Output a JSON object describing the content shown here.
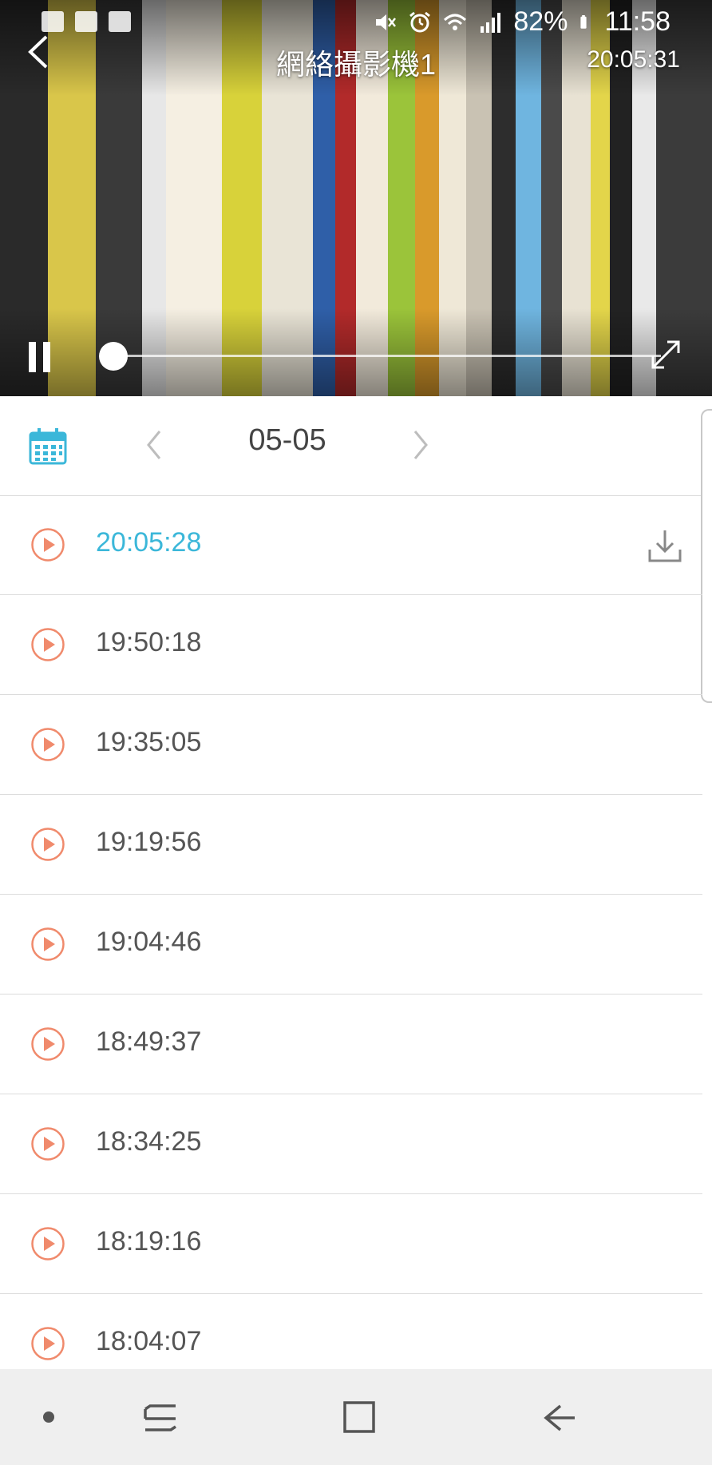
{
  "status_bar": {
    "battery": "82%",
    "time": "11:58"
  },
  "player": {
    "camera_name": "網絡攝影機1",
    "timestamp": "20:05:31",
    "playback_progress": 0.02
  },
  "date_nav": {
    "date": "05-05"
  },
  "recordings": [
    {
      "time": "20:05:28",
      "active": true,
      "downloadable": true
    },
    {
      "time": "19:50:18"
    },
    {
      "time": "19:35:05"
    },
    {
      "time": "19:19:56"
    },
    {
      "time": "19:04:46"
    },
    {
      "time": "18:49:37"
    },
    {
      "time": "18:34:25"
    },
    {
      "time": "18:19:16"
    },
    {
      "time": "18:04:07"
    }
  ],
  "colors": {
    "accent": "#3bb7d9",
    "play_icon": "#f08a6c",
    "text": "#555555",
    "divider": "#dcdcdc",
    "nav_background": "#efefef"
  }
}
